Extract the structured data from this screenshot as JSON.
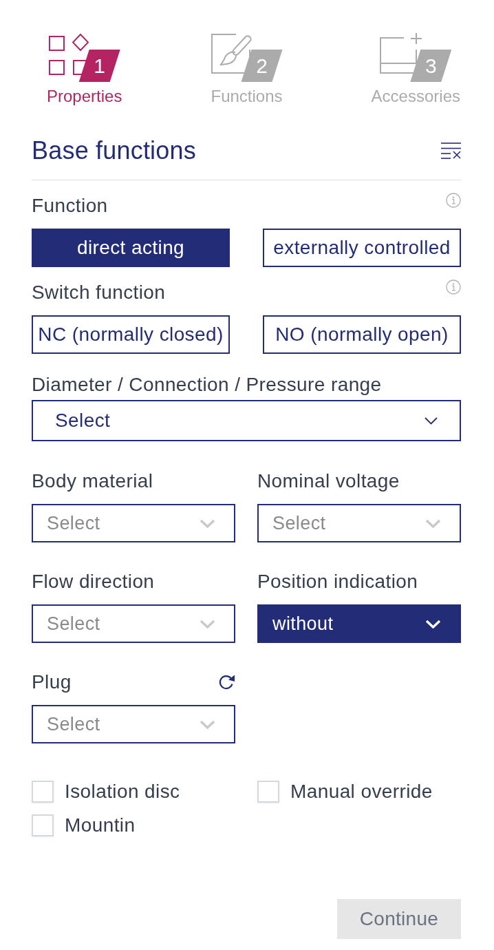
{
  "steps": [
    {
      "number": "1",
      "label": "Properties",
      "selected": true
    },
    {
      "number": "2",
      "label": "Functions",
      "selected": false
    },
    {
      "number": "3",
      "label": "Accessories",
      "selected": false
    }
  ],
  "section": {
    "title": "Base functions"
  },
  "toggle_groups": [
    {
      "label": "Function",
      "info": true,
      "options": [
        {
          "label": "direct acting",
          "selected": true
        },
        {
          "label": "externally controlled",
          "selected": false
        }
      ]
    },
    {
      "label": "Switch function",
      "info": true,
      "options": [
        {
          "label": "NC (normally closed)",
          "selected": false
        },
        {
          "label": "NO (normally open)",
          "selected": false
        }
      ]
    }
  ],
  "range_select": {
    "label": "Diameter / Connection / Pressure range",
    "placeholder": "Select"
  },
  "selects": [
    {
      "label": "Body material",
      "placeholder": "Select",
      "reset": false
    },
    {
      "label": "Nominal voltage",
      "placeholder": "Select",
      "reset": false
    },
    {
      "label": "Flow direction",
      "placeholder": "Select",
      "reset": false
    },
    {
      "label": "Position indication",
      "value": "without",
      "reset": false
    },
    {
      "label": "Plug",
      "placeholder": "Select",
      "reset": true
    }
  ],
  "checkboxes": [
    {
      "label": "Isolation disc",
      "checked": false
    },
    {
      "label": "Manual override",
      "checked": false
    },
    {
      "label": "Mountin",
      "checked": false
    }
  ],
  "continue_button": {
    "label": "Continue",
    "disabled": true
  }
}
